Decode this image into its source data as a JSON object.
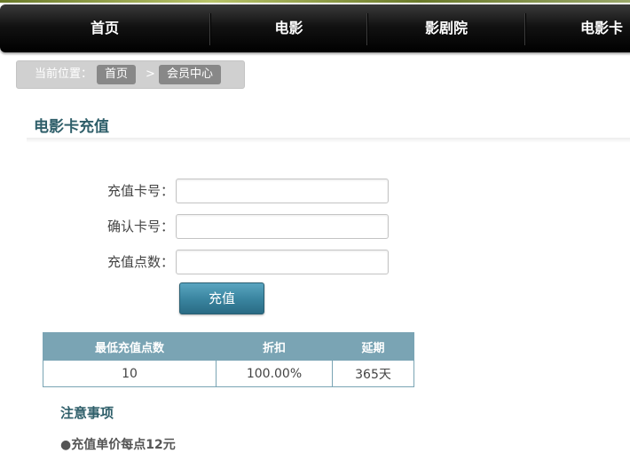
{
  "nav": {
    "items": [
      {
        "label": "首页"
      },
      {
        "label": "电影"
      },
      {
        "label": "影剧院"
      },
      {
        "label": "电影卡"
      }
    ]
  },
  "breadcrumb": {
    "label": "当前位置：",
    "items": [
      "首页",
      "会员中心"
    ],
    "separator": ">"
  },
  "page": {
    "title": "电影卡充值"
  },
  "form": {
    "card_number_label": "充值卡号：",
    "confirm_card_label": "确认卡号：",
    "points_label": "充值点数：",
    "card_number_value": "",
    "confirm_card_value": "",
    "points_value": "",
    "submit_label": "充值"
  },
  "table": {
    "headers": [
      "最低充值点数",
      "折扣",
      "延期"
    ],
    "rows": [
      [
        "10",
        "100.00%",
        "365天"
      ]
    ]
  },
  "notes": {
    "title": "注意事项",
    "lines": [
      "●充值单价每点12元"
    ]
  },
  "colors": {
    "nav_bg": "#000000",
    "accent": "#3b86a1",
    "title_color": "#2f5f6a",
    "table_header": "#7aa4b4"
  }
}
